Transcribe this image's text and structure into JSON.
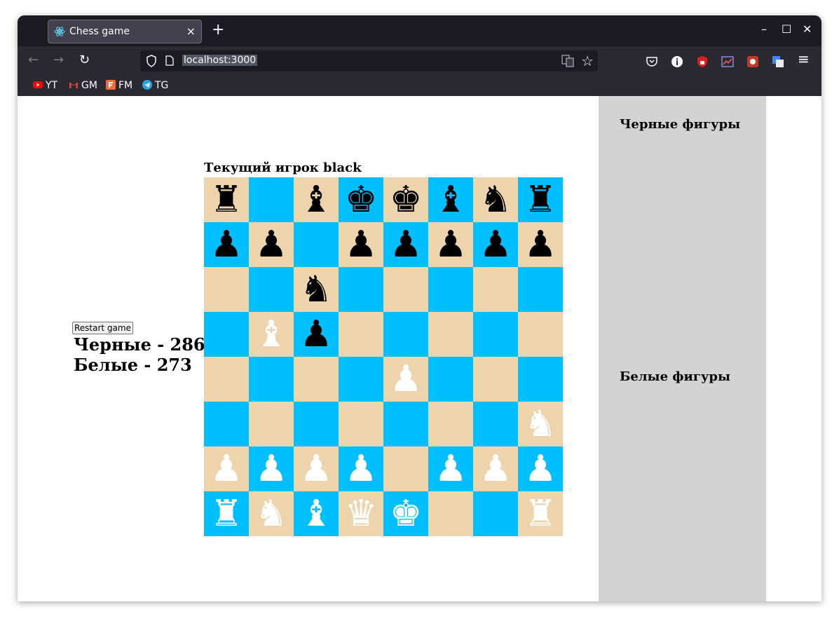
{
  "browser": {
    "tab_title": "Chess game",
    "tab_close": "×",
    "new_tab": "+",
    "url": "localhost:3000",
    "window_controls": {
      "minimize": "–",
      "maximize": "☐",
      "close": "✕"
    },
    "nav": {
      "back": "←",
      "forward": "→",
      "reload": "↻",
      "star": "☆",
      "menu": "≡"
    },
    "bookmarks": [
      {
        "label": "YT",
        "icon": "youtube-icon",
        "color": "#ff0000"
      },
      {
        "label": "GM",
        "icon": "gmail-icon",
        "color": "#ea4335"
      },
      {
        "label": "FM",
        "icon": "fm-icon",
        "color": "#f26c3a"
      },
      {
        "label": "TG",
        "icon": "telegram-icon",
        "color": "#2aa3e0"
      }
    ]
  },
  "game": {
    "restart_label": "Restart game",
    "black_score": "Черные - 286",
    "white_score": "Белые - 273",
    "current_player": "Текущий игрок black",
    "black_pieces_title": "Черные фигуры",
    "white_pieces_title": "Белые фигуры",
    "colors": {
      "light_square": "#eed4ac",
      "dark_square": "#00bfff",
      "panel": "#d3d3d3"
    },
    "board": [
      [
        "bR",
        "",
        "bB",
        "bK",
        "bK",
        "bB",
        "bN",
        "bR"
      ],
      [
        "bP",
        "bP",
        "",
        "bP",
        "bP",
        "bP",
        "bP",
        "bP"
      ],
      [
        "",
        "",
        "bN",
        "",
        "",
        "",
        "",
        ""
      ],
      [
        "",
        "wB",
        "bP",
        "",
        "",
        "",
        "",
        ""
      ],
      [
        "",
        "",
        "",
        "",
        "wP",
        "",
        "",
        ""
      ],
      [
        "",
        "",
        "",
        "",
        "",
        "",
        "",
        "wN"
      ],
      [
        "wP",
        "wP",
        "wP",
        "wP",
        "",
        "wP",
        "wP",
        "wP"
      ],
      [
        "wR",
        "wN",
        "wB",
        "wQ",
        "wK",
        "",
        "",
        "wR"
      ]
    ],
    "glyphs": {
      "R": "♜",
      "N": "♞",
      "B": "♝",
      "Q": "♛",
      "K": "♚",
      "P": "♟"
    }
  }
}
